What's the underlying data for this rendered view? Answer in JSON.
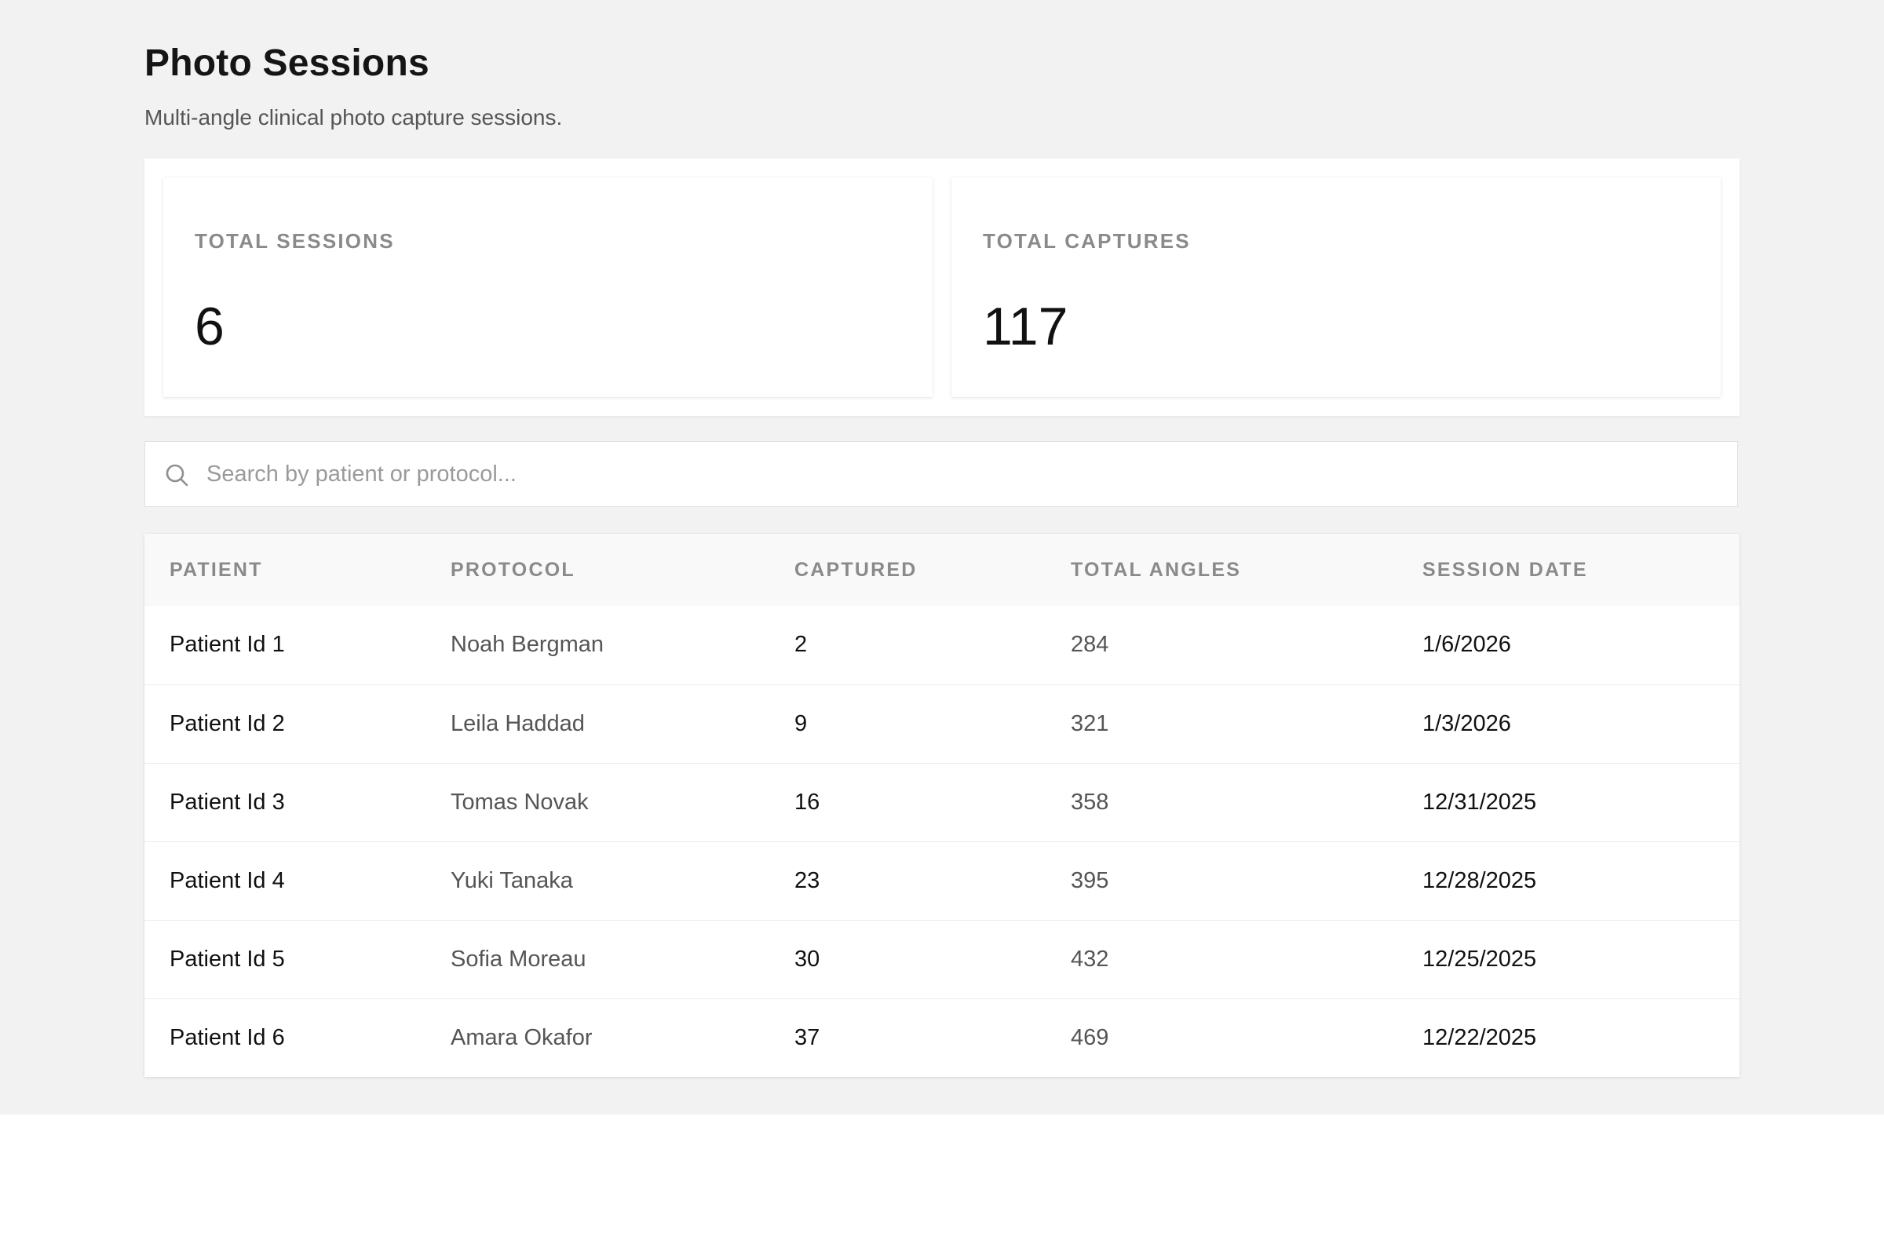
{
  "header": {
    "title": "Photo Sessions",
    "subtitle": "Multi-angle clinical photo capture sessions."
  },
  "stats": {
    "total_sessions": {
      "label": "TOTAL SESSIONS",
      "value": "6"
    },
    "total_captures": {
      "label": "TOTAL CAPTURES",
      "value": "117"
    }
  },
  "search": {
    "placeholder": "Search by patient or protocol...",
    "value": "",
    "icon": "search-icon"
  },
  "table": {
    "columns": [
      "PATIENT",
      "PROTOCOL",
      "CAPTURED",
      "TOTAL ANGLES",
      "SESSION DATE"
    ],
    "rows": [
      {
        "patient": "Patient Id 1",
        "protocol": "Noah Bergman",
        "captured": "2",
        "total_angles": "284",
        "session_date": "1/6/2026"
      },
      {
        "patient": "Patient Id 2",
        "protocol": "Leila Haddad",
        "captured": "9",
        "total_angles": "321",
        "session_date": "1/3/2026"
      },
      {
        "patient": "Patient Id 3",
        "protocol": "Tomas Novak",
        "captured": "16",
        "total_angles": "358",
        "session_date": "12/31/2025"
      },
      {
        "patient": "Patient Id 4",
        "protocol": "Yuki Tanaka",
        "captured": "23",
        "total_angles": "395",
        "session_date": "12/28/2025"
      },
      {
        "patient": "Patient Id 5",
        "protocol": "Sofia Moreau",
        "captured": "30",
        "total_angles": "432",
        "session_date": "12/25/2025"
      },
      {
        "patient": "Patient Id 6",
        "protocol": "Amara Okafor",
        "captured": "37",
        "total_angles": "469",
        "session_date": "12/22/2025"
      }
    ]
  },
  "colors": {
    "page_background": "#f2f2f2",
    "card_background": "#ffffff",
    "muted_text": "#8a8a8a"
  }
}
